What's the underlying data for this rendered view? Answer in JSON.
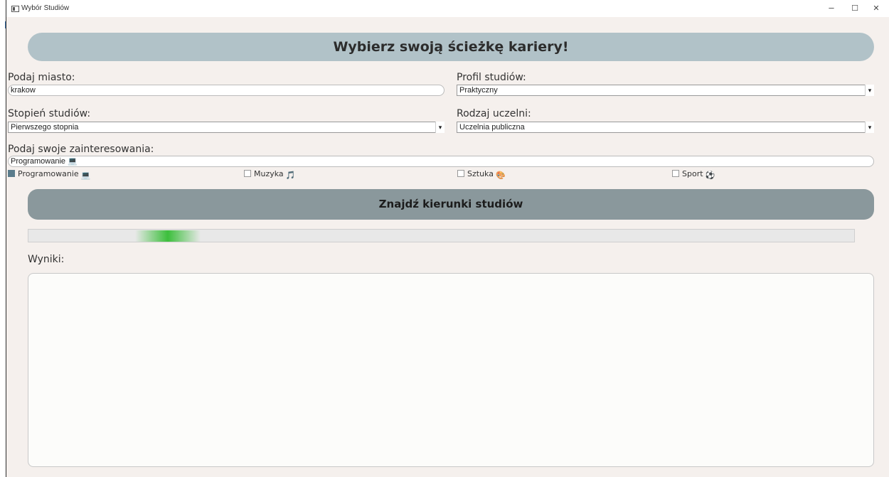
{
  "window": {
    "title": "Wybór Studiów",
    "minimize": "–",
    "maximize": "☐",
    "close": "✕"
  },
  "header": {
    "title": "Wybierz swoją ścieżkę kariery!"
  },
  "form": {
    "city": {
      "label": "Podaj miasto:",
      "value": "krakow"
    },
    "profile": {
      "label": "Profil studiów:",
      "value": "Praktyczny"
    },
    "degree": {
      "label": "Stopień studiów:",
      "value": "Pierwszego stopnia"
    },
    "university": {
      "label": "Rodzaj uczelni:",
      "value": "Uczelnia publiczna"
    },
    "interests": {
      "label": "Podaj swoje zainteresowania:",
      "value": "Programowanie 💻"
    }
  },
  "checkboxes": [
    {
      "label": "Programowanie",
      "emoji": "💻",
      "checked": true,
      "icon": "computer-icon"
    },
    {
      "label": "Muzyka",
      "emoji": "🎵",
      "checked": false,
      "icon": "music-icon"
    },
    {
      "label": "Sztuka",
      "emoji": "🎨",
      "checked": false,
      "icon": "palette-icon"
    },
    {
      "label": "Sport",
      "emoji": "⚽",
      "checked": false,
      "icon": "ball-icon"
    }
  ],
  "search_button": {
    "label": "Znajdź kierunki studiów"
  },
  "results": {
    "label": "Wyniki:",
    "value": ""
  },
  "colors": {
    "header_bg": "#b1c2c8",
    "button_bg": "#8a989c",
    "window_bg": "#f5f0ed",
    "checked": "#5a7c8c",
    "progress": "#3cbf3c"
  }
}
